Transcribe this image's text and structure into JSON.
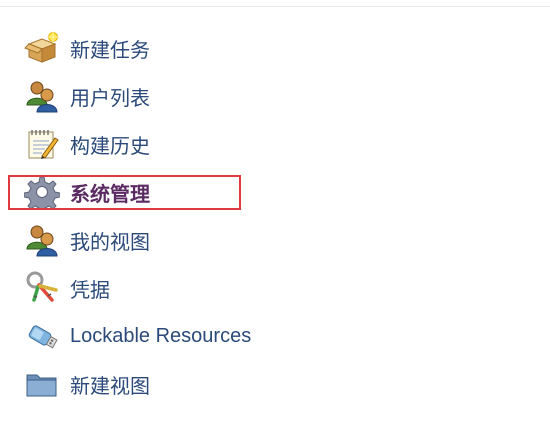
{
  "tasks": [
    {
      "label": "新建任务",
      "icon": "new-item-box-icon"
    },
    {
      "label": "用户列表",
      "icon": "people-icon"
    },
    {
      "label": "构建历史",
      "icon": "notepad-icon"
    },
    {
      "label": "系统管理",
      "icon": "gear-icon",
      "active": true
    },
    {
      "label": "我的视图",
      "icon": "people-icon"
    },
    {
      "label": "凭据",
      "icon": "keys-icon"
    },
    {
      "label": "Lockable Resources",
      "icon": "usb-drive-icon"
    },
    {
      "label": "新建视图",
      "icon": "folder-icon"
    }
  ],
  "colors": {
    "link": "#2b4a7a",
    "active_link": "#5b2a63",
    "highlight_border": "#e0393e"
  }
}
